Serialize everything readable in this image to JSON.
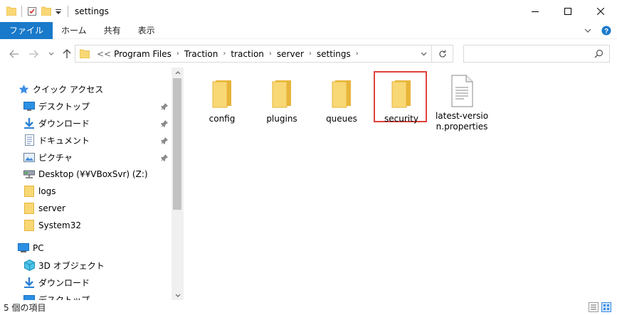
{
  "window": {
    "title": "settings",
    "minimize_icon": "minimize-icon",
    "maximize_icon": "maximize-icon",
    "close_icon": "close-icon"
  },
  "ribbon": {
    "tabs": [
      {
        "label": "ファイル",
        "active": true
      },
      {
        "label": "ホーム"
      },
      {
        "label": "共有"
      },
      {
        "label": "表示"
      }
    ]
  },
  "address": {
    "overflow": "<<",
    "crumbs": [
      "Program Files",
      "Traction",
      "traction",
      "server",
      "settings"
    ]
  },
  "search": {
    "placeholder": ""
  },
  "nav": {
    "quick_access": "クイック アクセス",
    "items": [
      {
        "label": "デスクトップ",
        "icon": "desktop-icon",
        "pinned": true
      },
      {
        "label": "ダウンロード",
        "icon": "download-icon",
        "pinned": true
      },
      {
        "label": "ドキュメント",
        "icon": "document-icon",
        "pinned": true
      },
      {
        "label": "ピクチャ",
        "icon": "picture-icon",
        "pinned": true
      },
      {
        "label": "Desktop (¥¥VBoxSvr) (Z:)",
        "icon": "network-drive-icon"
      },
      {
        "label": "logs",
        "icon": "folder-icon"
      },
      {
        "label": "server",
        "icon": "folder-icon"
      },
      {
        "label": "System32",
        "icon": "folder-icon"
      }
    ],
    "pc": "PC",
    "pc_items": [
      {
        "label": "3D オブジェクト",
        "icon": "3d-objects-icon"
      },
      {
        "label": "ダウンロード",
        "icon": "download-icon"
      },
      {
        "label": "デスクトップ",
        "icon": "desktop-icon"
      }
    ]
  },
  "files": [
    {
      "name": "config",
      "type": "folder"
    },
    {
      "name": "plugins",
      "type": "folder"
    },
    {
      "name": "queues",
      "type": "folder"
    },
    {
      "name": "security",
      "type": "folder",
      "highlighted": true
    },
    {
      "name": "latest-version.properties",
      "type": "file"
    }
  ],
  "status": {
    "count": "5 個の項目"
  },
  "colors": {
    "accent": "#1979ca",
    "folder": "#f8d775",
    "folder_dark": "#e8b53a",
    "highlight": "#e0413c"
  }
}
